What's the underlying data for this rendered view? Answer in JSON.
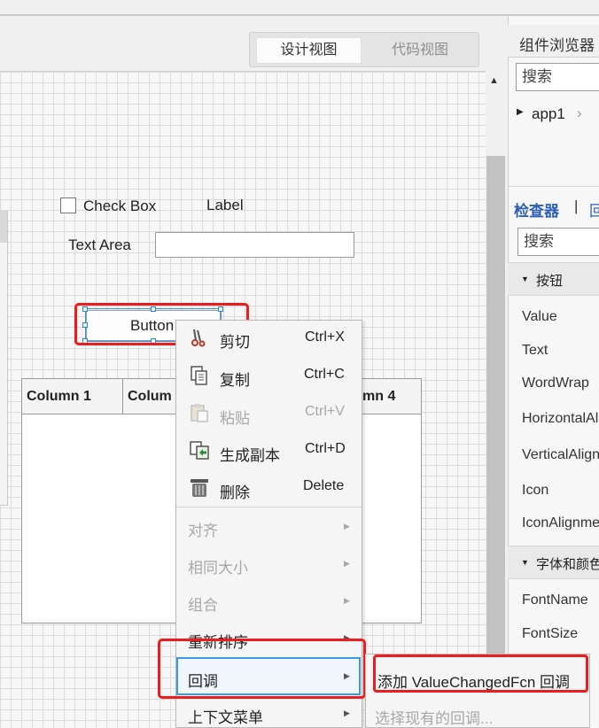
{
  "view_toggle": {
    "design": "设计视图",
    "code": "代码视图"
  },
  "canvas": {
    "checkbox_label": "Check Box",
    "label_text": "Label",
    "textarea_label": "Text Area",
    "button_text": "Button",
    "table_columns": [
      "Column 1",
      "Colum",
      "mn 4"
    ]
  },
  "context_menu": {
    "items": [
      {
        "label": "剪切",
        "shortcut": "Ctrl+X",
        "enabled": true
      },
      {
        "label": "复制",
        "shortcut": "Ctrl+C",
        "enabled": true
      },
      {
        "label": "粘贴",
        "shortcut": "Ctrl+V",
        "enabled": false
      },
      {
        "label": "生成副本",
        "shortcut": "Ctrl+D",
        "enabled": true
      },
      {
        "label": "删除",
        "shortcut": "Delete",
        "enabled": true
      }
    ],
    "submenus": [
      {
        "label": "对齐",
        "enabled": false
      },
      {
        "label": "相同大小",
        "enabled": false
      },
      {
        "label": "组合",
        "enabled": false
      },
      {
        "label": "重新排序",
        "enabled": true
      },
      {
        "label": "回调",
        "enabled": true,
        "highlighted": true
      },
      {
        "label": "上下文菜单",
        "enabled": true
      }
    ]
  },
  "callback_submenu": {
    "add": "添加 ValueChangedFcn 回调",
    "select_existing": "选择现有的回调..."
  },
  "right_panel": {
    "title": "组件浏览器",
    "search_placeholder": "搜索",
    "tree_node": "app1",
    "inspector_tab": "检查器",
    "separator": "|",
    "callback_tab_partial": "回",
    "inspector_search_placeholder": "搜索",
    "section_button": "按钮",
    "button_props": [
      "Value",
      "Text",
      "WordWrap",
      "HorizontalAl",
      "VerticalAlign",
      "Icon",
      "IconAlignme"
    ],
    "section_font": "字体和颜色",
    "font_props": [
      "FontName",
      "FontSize"
    ]
  },
  "colors": {
    "annotation_red": "#ee1c1c",
    "selection_blue": "#3b9ae1",
    "inspector_link": "#2f5fb3"
  }
}
